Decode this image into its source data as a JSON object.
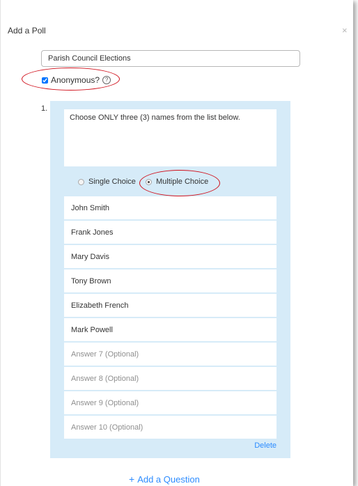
{
  "dialog": {
    "title": "Add a Poll",
    "close_glyph": "×"
  },
  "poll": {
    "title_value": "Parish Council Elections",
    "anonymous_label": "Anonymous?",
    "anonymous_checked": true,
    "help_glyph": "?"
  },
  "question": {
    "number": "1.",
    "text": "Choose ONLY three (3) names from the list below.",
    "types": [
      {
        "label": "Single Choice",
        "selected": false
      },
      {
        "label": "Multiple Choice",
        "selected": true
      }
    ],
    "answers": [
      {
        "value": "John Smith",
        "placeholder": ""
      },
      {
        "value": "Frank Jones",
        "placeholder": ""
      },
      {
        "value": "Mary Davis",
        "placeholder": ""
      },
      {
        "value": "Tony Brown",
        "placeholder": ""
      },
      {
        "value": "Elizabeth French",
        "placeholder": ""
      },
      {
        "value": "Mark Powell",
        "placeholder": ""
      },
      {
        "value": "",
        "placeholder": "Answer 7 (Optional)"
      },
      {
        "value": "",
        "placeholder": "Answer 8 (Optional)"
      },
      {
        "value": "",
        "placeholder": "Answer 9 (Optional)"
      },
      {
        "value": "",
        "placeholder": "Answer 10 (Optional)"
      }
    ],
    "delete_label": "Delete"
  },
  "footer": {
    "add_question_icon": "+",
    "add_question_label": "Add a Question"
  },
  "colors": {
    "accent": "#2d8cff",
    "panel": "#d6ebf8",
    "annotation": "#d0101b"
  }
}
